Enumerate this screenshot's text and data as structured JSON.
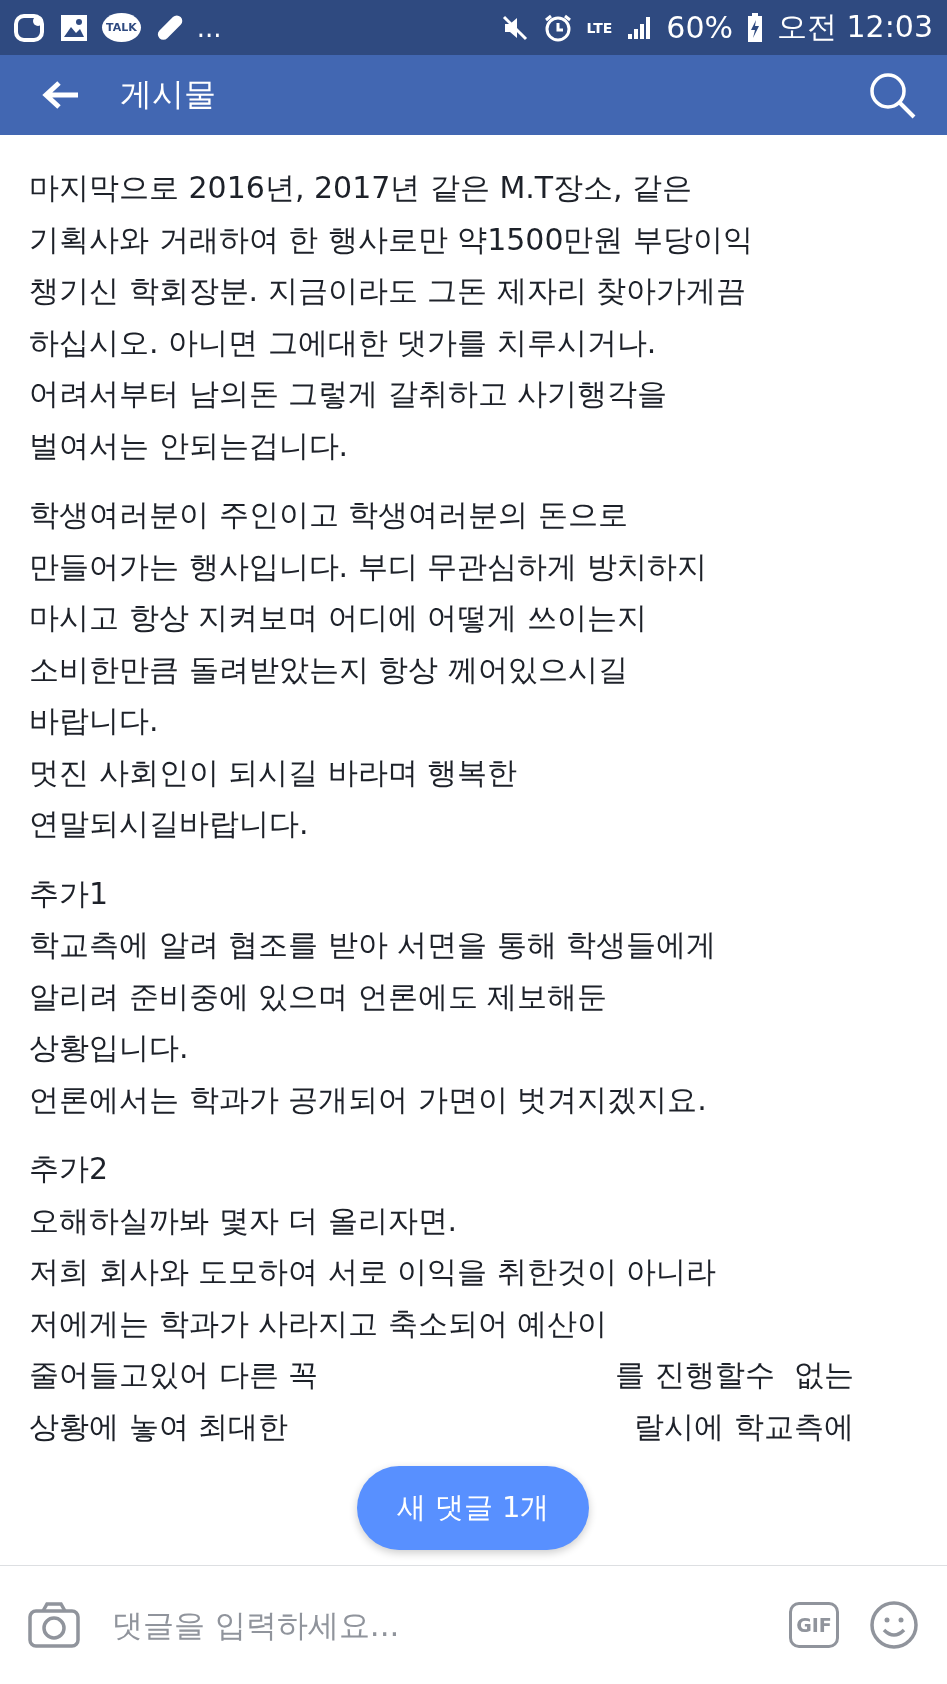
{
  "status_bar": {
    "more": "...",
    "talk": "TALK",
    "network": "LTE",
    "battery": "60%",
    "time": "오전 12:03"
  },
  "header": {
    "title": "게시물"
  },
  "paragraphs": [
    {
      "lines": [
        "마지막으로 2016년, 2017년 같은 M.T장소, 같은",
        "기획사와 거래하여 한 행사로만 약1500만원 부당이익",
        "챙기신 학회장분. 지금이라도 그돈 제자리 찾아가게끔",
        "하십시오. 아니면 그에대한 댓가를 치루시거나.",
        "어려서부터 남의돈 그렇게 갈취하고 사기행각을",
        "벌여서는 안되는겁니다."
      ]
    },
    {
      "lines": [
        "학생여러분이 주인이고 학생여러분의 돈으로",
        "만들어가는 행사입니다. 부디 무관심하게 방치하지",
        "마시고 항상 지켜보며 어디에 어떻게 쓰이는지",
        "소비한만큼 돌려받았는지 항상 께어있으시길",
        "바랍니다.",
        "멋진 사회인이 되시길 바라며 행복한",
        "연말되시길바랍니다."
      ]
    },
    {
      "lines": [
        "추가1",
        "학교측에 알려 협조를 받아 서면을 통해 학생들에게",
        "알리려 준비중에 있으며 언론에도 제보해둔",
        "상황입니다.",
        "언론에서는 학과가 공개되어 가면이 벗겨지겠지요."
      ]
    },
    {
      "lines": [
        "추가2",
        "오해하실까봐 몇자 더 올리자면.",
        "저희 회사와 도모하여 서로 이익을 취한것이 아니라",
        "저에게는 학과가 사라지고 축소되어 예산이"
      ]
    }
  ],
  "covered_lines": [
    {
      "left": "줄어들고있어 다른 꼭",
      "right": "를 진행할수  없는"
    },
    {
      "left": "상황에 놓여 최대한",
      "right": "랄시에 학교측에"
    }
  ],
  "new_comment_pill": "새 댓글 1개",
  "comment_bar": {
    "placeholder": "댓글을 입력하세요...",
    "gif": "GIF"
  }
}
